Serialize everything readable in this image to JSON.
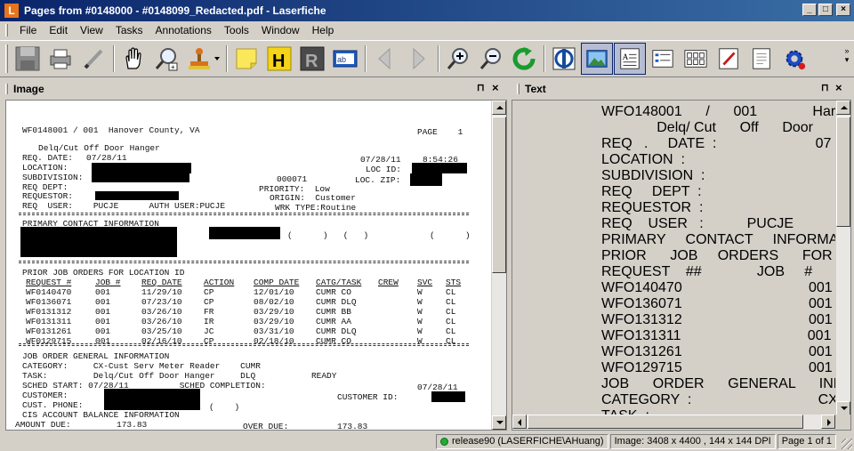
{
  "window": {
    "app_logo_letter": "L",
    "title": "Pages from #0148000 - #0148099_Redacted.pdf - Laserfiche",
    "minimize": "_",
    "maximize": "□",
    "close": "×"
  },
  "menu": [
    "File",
    "Edit",
    "View",
    "Tasks",
    "Annotations",
    "Tools",
    "Window",
    "Help"
  ],
  "toolbar_icons": [
    "save-icon",
    "print-icon",
    "pen-icon",
    "hand-pan-icon",
    "zoom-area-icon",
    "stamp-icon",
    "sticky-note-icon",
    "highlight-icon",
    "redact-icon",
    "text-box-icon",
    "previous-page-icon",
    "next-page-icon",
    "zoom-in-icon",
    "zoom-out-icon",
    "rotate-icon",
    "ocr-icon",
    "image-view-icon",
    "text-view-icon",
    "metadata-icon",
    "thumbnails-icon",
    "edit-document-icon",
    "document-properties-icon",
    "settings-icon"
  ],
  "toolbar_labels": {
    "highlight": "H",
    "redact": "R",
    "textbox": "ab"
  },
  "image_pane": {
    "title": "Image",
    "pin": "⊓",
    "close": "×",
    "document": {
      "header_left": "WF0148001 / 001  Hanover County, VA",
      "header_right": "PAGE    1",
      "subtitle": "Delq/Cut Off Door Hanger",
      "req_date_label": "REQ. DATE:",
      "req_date": "07/28/11",
      "print_date": "07/28/11",
      "print_time": "8:54:26",
      "location_label": "LOCATION:",
      "loc_id_label": "LOC ID:",
      "subdivision_label": "SUBDIVISION:",
      "subdivision_code": "000071",
      "loc_zip_label": "LOC. ZIP:",
      "req_dept_label": "REQ DEPT:",
      "priority": "PRIORITY:  Low",
      "requestor_label": "REQUESTOR:",
      "origin": "ORIGIN:  Customer",
      "req_user": "REQ  USER:    PUCJE      AUTH USER:PUCJE",
      "wrk_type": "WRK TYPE:Routine",
      "primary_contact": "PRIMARY CONTACT INFORMATION",
      "phone_parens_1": "(      )   (   )",
      "phone_parens_2": "(      )",
      "prior_header": "PRIOR JOB ORDERS FOR LOCATION ID",
      "columns": [
        "REQUEST #",
        "JOB #",
        "REQ DATE",
        "ACTION",
        "COMP DATE",
        "CATG/TASK",
        "CREW",
        "SVC",
        "STS"
      ],
      "rows": [
        [
          "WF0140470",
          "001",
          "11/29/10",
          "CP",
          "12/01/10",
          "CUMR CO",
          "",
          "W",
          "CL"
        ],
        [
          "WF0136071",
          "001",
          "07/23/10",
          "CP",
          "08/02/10",
          "CUMR DLQ",
          "",
          "W",
          "CL"
        ],
        [
          "WF0131312",
          "001",
          "03/26/10",
          "FR",
          "03/29/10",
          "CUMR BB",
          "",
          "W",
          "CL"
        ],
        [
          "WF0131311",
          "001",
          "03/26/10",
          "IR",
          "03/29/10",
          "CUMR AA",
          "",
          "W",
          "CL"
        ],
        [
          "WF0131261",
          "001",
          "03/25/10",
          "JC",
          "03/31/10",
          "CUMR DLQ",
          "",
          "W",
          "CL"
        ],
        [
          "WF0129715",
          "001",
          "02/16/10",
          "CP",
          "02/18/10",
          "CUMR CO",
          "",
          "W",
          "CL"
        ]
      ],
      "job_order_header": "JOB ORDER GENERAL INFORMATION",
      "category": "CATEGORY:     CX-Cust Serv Meter Reader    CUMR",
      "task": "TASK:         Delq/Cut Off Door Hanger     DLQ           READY",
      "sched_start": "SCHED START: 07/28/11          SCHED COMPLETION:",
      "sched_completion_date": "07/28/11",
      "customer_label": "CUSTOMER:",
      "customer_id_label": "CUSTOMER ID:",
      "cust_phone_label": "CUST. PHONE:",
      "cust_phone_parens": "(    )",
      "cis_header": "CIS ACCOUNT BALANCE INFORMATION",
      "amount_due": "AMOUNT DUE:         173.83",
      "over_due_label": "OVER DUE:",
      "over_due": "173.83"
    }
  },
  "text_pane": {
    "title": "Text",
    "pin": "⊓",
    "close": "×",
    "lines": [
      "WFO148001      /      001              Har",
      "              Delq/ Cut      Off      Door",
      "REQ   .     DATE  :                         07",
      "LOCATION  :",
      "SUBDIVISION  :",
      "REQ     DEPT  :",
      "REQUESTOR  :",
      "REQ    USER   :           PUCJE",
      "PRIMARY     CONTACT     INFORMA",
      "PRIOR      JOB     ORDERS      FOR",
      "REQUEST    ##              JOB     #",
      "WFO140470                                001",
      "WFO136071                                001",
      "WFO131312                                001",
      "WFO131311                                001",
      "WFO131261                                001",
      "WFO129715                                001",
      "JOB      ORDER      GENERAL      INF",
      "CATEGORY  :                                CX",
      "TASK  :"
    ]
  },
  "status": {
    "connection": "release90 (LASERFICHE\\AHuang)",
    "image_info": "Image: 3408 x 4400 , 144 x 144 DPI",
    "page": "Page 1 of 1"
  }
}
